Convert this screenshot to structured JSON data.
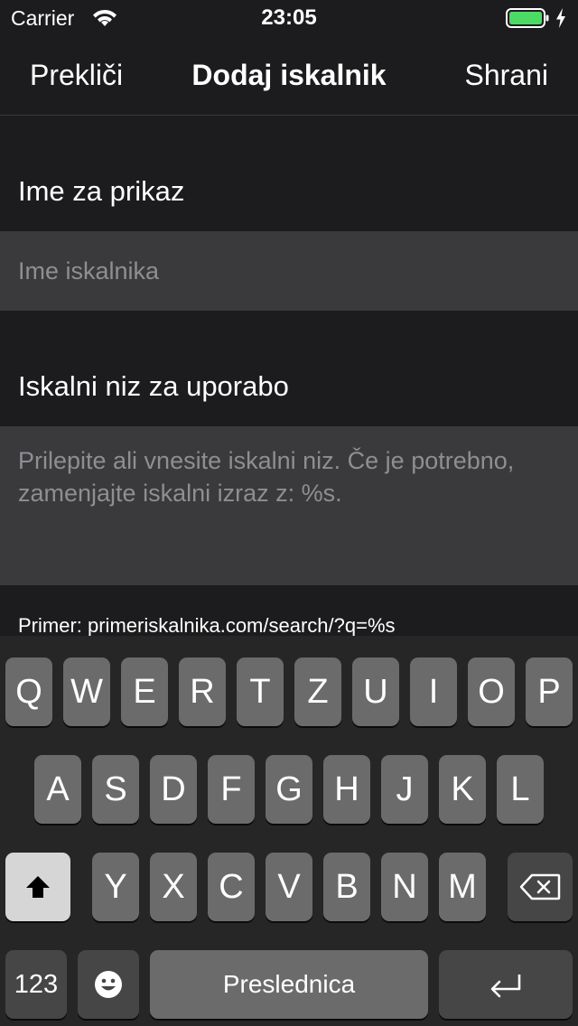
{
  "status_bar": {
    "carrier": "Carrier",
    "time": "23:05",
    "battery_color": "#4cd964"
  },
  "nav": {
    "cancel": "Prekliči",
    "title": "Dodaj iskalnik",
    "save": "Shrani"
  },
  "form": {
    "name_header": "Ime za prikaz",
    "name_placeholder": "Ime iskalnika",
    "query_header": "Iskalni niz za uporabo",
    "query_placeholder_line1": "Prilepite ali vnesite iskalni niz. Če je potrebno,",
    "query_placeholder_line2": "zamenjajte iskalni izraz z: %s.",
    "example": "Primer: primeriskalnika.com/search/?q=%s"
  },
  "keyboard": {
    "row1": [
      "Q",
      "W",
      "E",
      "R",
      "T",
      "Z",
      "U",
      "I",
      "O",
      "P"
    ],
    "row2": [
      "A",
      "S",
      "D",
      "F",
      "G",
      "H",
      "J",
      "K",
      "L"
    ],
    "row3": [
      "Y",
      "X",
      "C",
      "V",
      "B",
      "N",
      "M"
    ],
    "numbers_key": "123",
    "space_key": "Preslednica",
    "shift_icon": "shift-icon",
    "delete_icon": "backspace-icon",
    "emoji_icon": "emoji-icon",
    "return_icon": "return-icon"
  }
}
